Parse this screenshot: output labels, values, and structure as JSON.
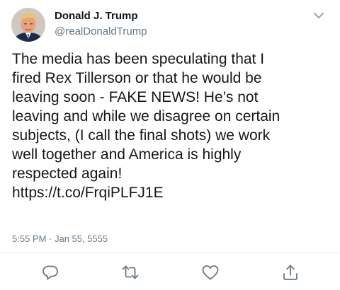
{
  "tweet": {
    "author_name": "Donald J. Trump",
    "author_handle": "@realDonaldTrump",
    "text_lines": [
      "The media has been speculating that I",
      "fired Rex Tillerson or that he would be",
      "leaving soon - FAKE NEWS! He’s not",
      "leaving and while we disagree on certain",
      "subjects, (I call the final shots) we work",
      "well together and America is highly",
      "respected again!"
    ],
    "link": "https://t.co/FrqiPLFJ1E",
    "timestamp": "5:55 PM · Jan 55, 5555"
  },
  "icons": {
    "menu": "chevron-down-icon",
    "reply": "reply-icon",
    "retweet": "retweet-icon",
    "like": "heart-icon",
    "share": "share-icon"
  },
  "colors": {
    "text": "#14171a",
    "secondary": "#657786",
    "icon": "#657786",
    "divider": "#e6ecf0"
  }
}
